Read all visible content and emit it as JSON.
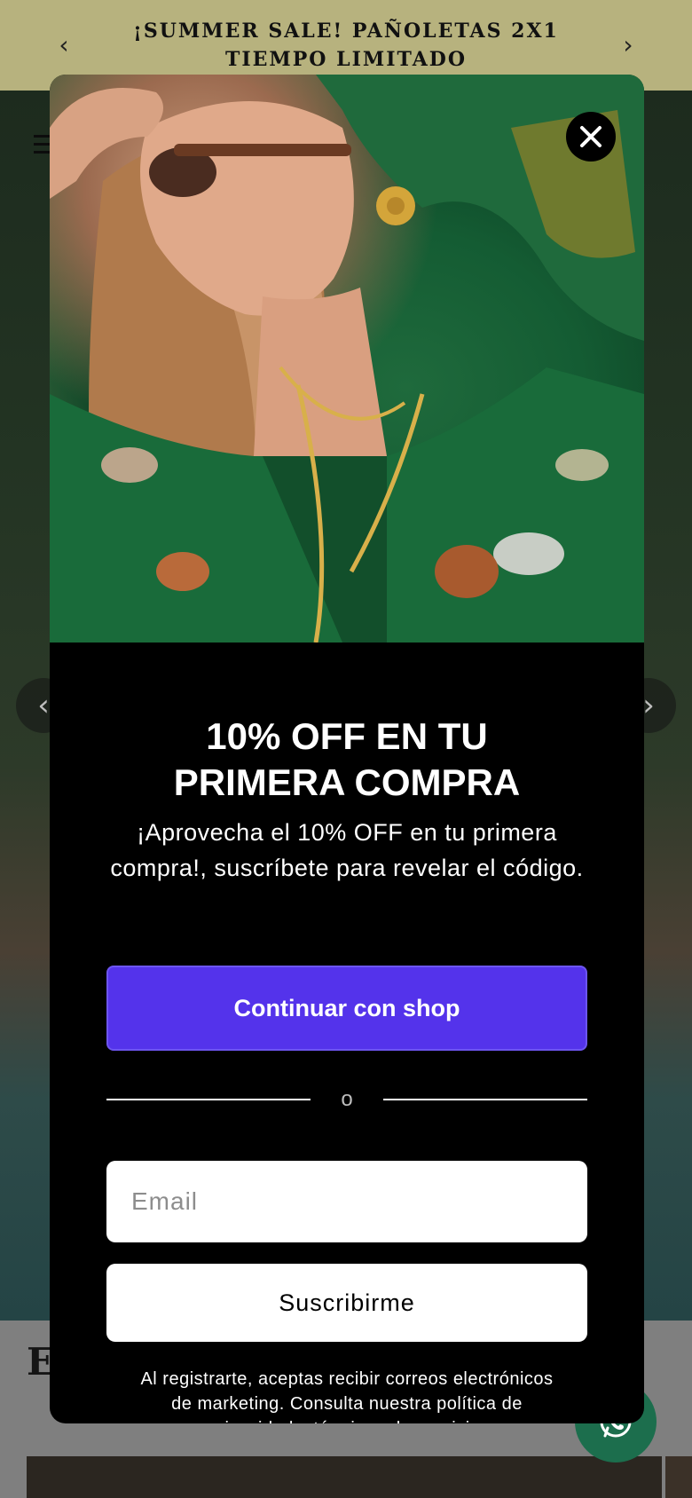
{
  "announcement": {
    "text": "¡SUMMER SALE! PAÑOLETAS 2X1 TIEMPO LIMITADO",
    "prev_icon": "chevron-left-icon",
    "next_icon": "chevron-right-icon"
  },
  "page": {
    "heading_fragment": "E",
    "slider_prev_icon": "chevron-left-icon",
    "slider_next_icon": "chevron-right-icon",
    "chat_icon": "whatsapp-icon"
  },
  "popup": {
    "close_icon": "close-icon",
    "headline_line1": "10% OFF EN TU",
    "headline_line2": "PRIMERA COMPRA",
    "subtext": "¡Aprovecha el 10% OFF en tu primera compra!, suscríbete para revelar el código.",
    "shop_button": "Continuar con shop",
    "divider_text": "o",
    "email_placeholder": "Email",
    "email_value": "",
    "subscribe_button": "Suscribirme",
    "legal": "Al registrarte, aceptas recibir correos electrónicos de marketing. Consulta nuestra política de privacidad y términos de servicio."
  },
  "colors": {
    "announcement_bg": "#b7b27e",
    "shop_button_bg": "#5433eb",
    "chat_bg": "#1c6e4d"
  }
}
